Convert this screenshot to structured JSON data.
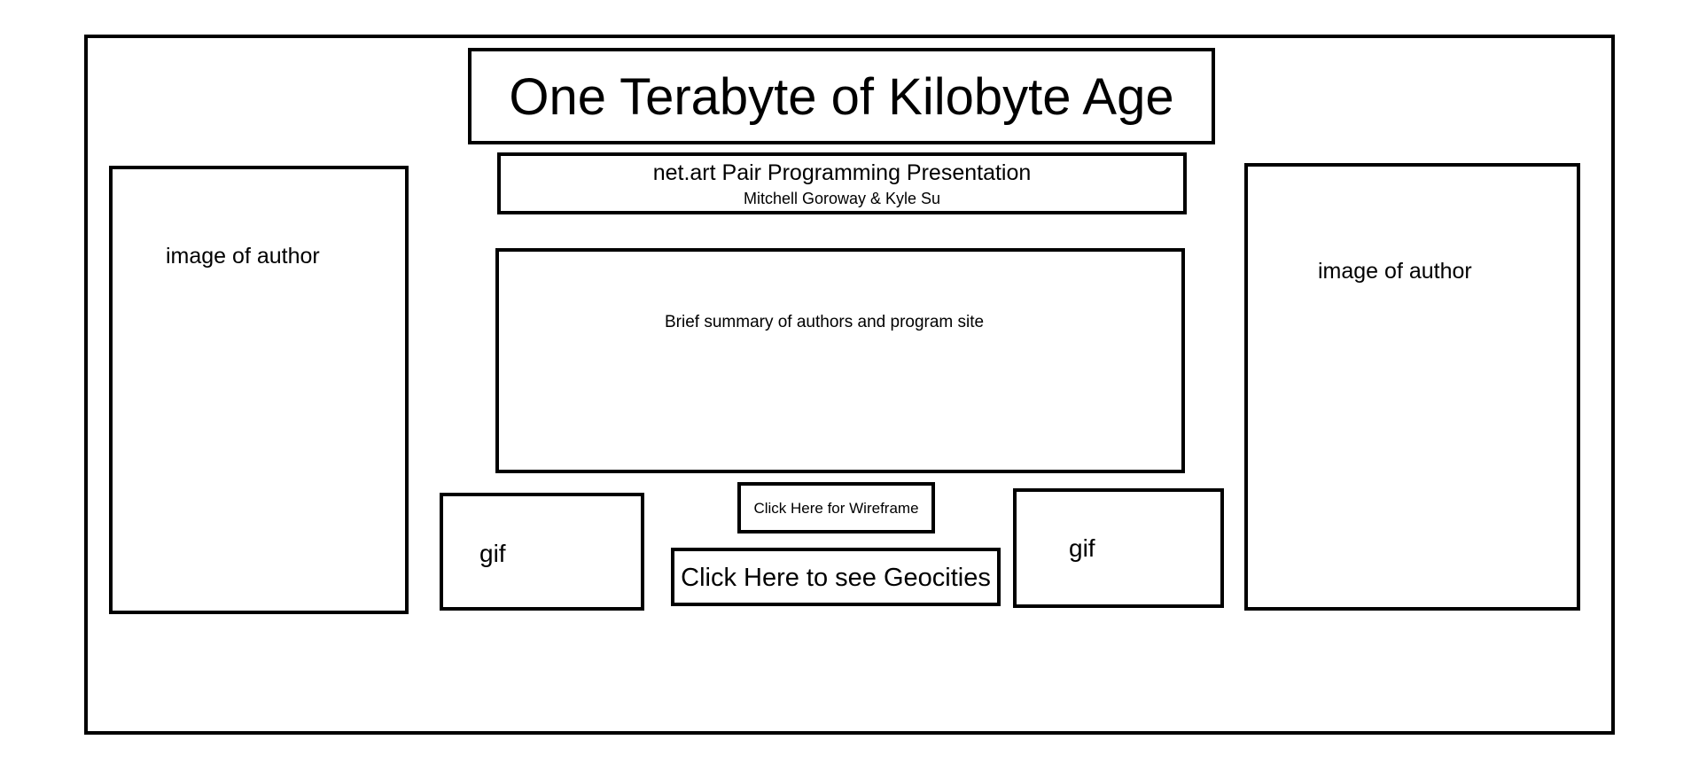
{
  "header": {
    "title": "One Terabyte of Kilobyte Age",
    "subtitle": "net.art Pair Programming Presentation",
    "authors": "Mitchell Goroway & Kyle Su"
  },
  "authors_images": {
    "left_label": "image of author",
    "right_label": "image of author"
  },
  "summary": {
    "text": "Brief summary of authors and program site"
  },
  "gifs": {
    "left_label": "gif",
    "right_label": "gif"
  },
  "links": {
    "wireframe": "Click Here for Wireframe",
    "geocities": "Click Here to see Geocities"
  }
}
